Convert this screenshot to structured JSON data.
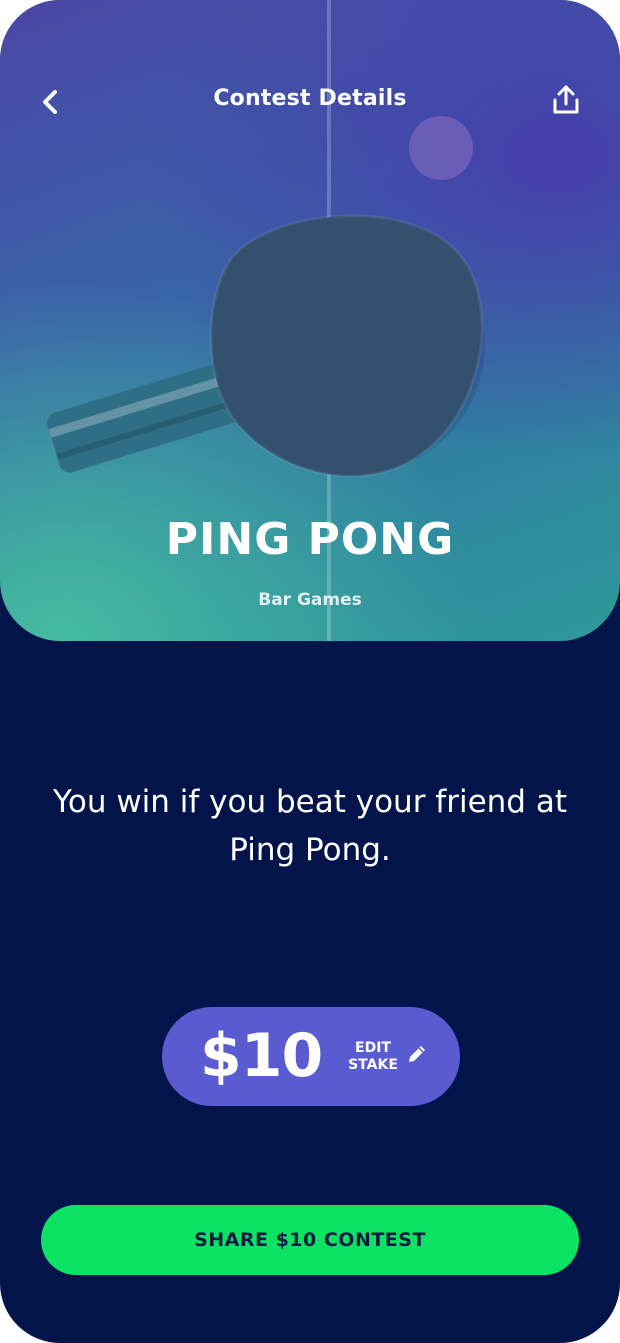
{
  "header": {
    "title": "Contest Details",
    "back_icon": "chevron-left-icon",
    "share_icon": "share-upload-icon"
  },
  "hero": {
    "title": "PING PONG",
    "category": "Bar Games",
    "image": "ping-pong-paddle-and-ball"
  },
  "description": "You win if you beat your friend at Ping Pong.",
  "stake": {
    "amount": "$10",
    "edit_line1": "EDIT",
    "edit_line2": "STAKE",
    "edit_icon": "pencil-icon"
  },
  "cta": {
    "label": "SHARE $10 CONTEST"
  },
  "colors": {
    "background": "#021449",
    "stake_pill": "#5B5BD1",
    "cta_button": "#0BE462",
    "cta_text": "#0B1B44"
  }
}
